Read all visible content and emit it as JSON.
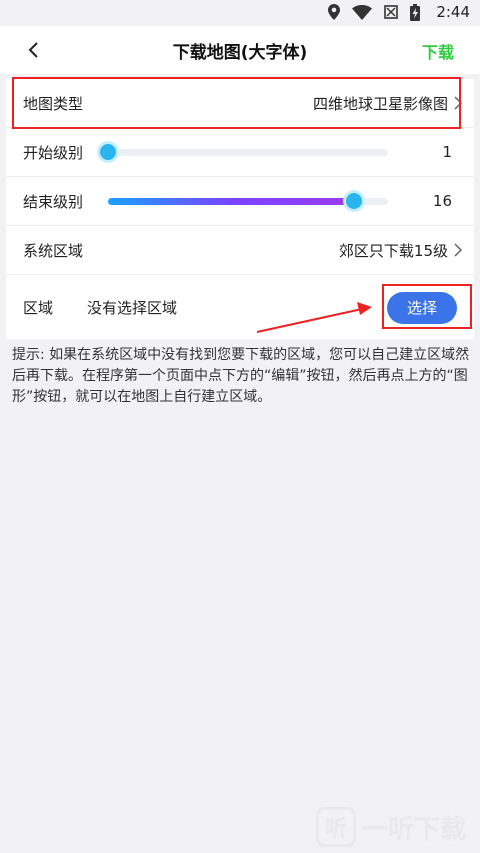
{
  "status_bar": {
    "time": "2:44",
    "icons": [
      "location-icon",
      "wifi-icon",
      "no-signal-icon",
      "battery-charging-icon"
    ]
  },
  "app_bar": {
    "title": "下载地图(大字体)",
    "download_label": "下载",
    "download_color": "#2ecc40"
  },
  "settings": {
    "map_type": {
      "label": "地图类型",
      "value": "四维地球卫星影像图"
    },
    "start_level": {
      "label": "开始级别",
      "value": "1",
      "level": 1
    },
    "end_level": {
      "label": "结束级别",
      "value": "16",
      "level": 16,
      "fill_fraction": 0.88
    },
    "system_area": {
      "label": "系统区域",
      "value": "郊区只下载15级"
    },
    "area": {
      "label": "区域",
      "value": "没有选择区域",
      "button_label": "选择"
    }
  },
  "hint": "提示: 如果在系统区域中没有找到您要下载的区域，您可以自己建立区域然后再下载。在程序第一个页面中点下方的“编辑”按钮，然后再点上方的“图形”按钮，就可以在地图上自行建立区域。",
  "watermark": {
    "text": "一听下载"
  },
  "colors": {
    "accent_blue": "#3b74e8",
    "annotation_red": "#e22222",
    "slider_knob": "#2bb5ee"
  }
}
